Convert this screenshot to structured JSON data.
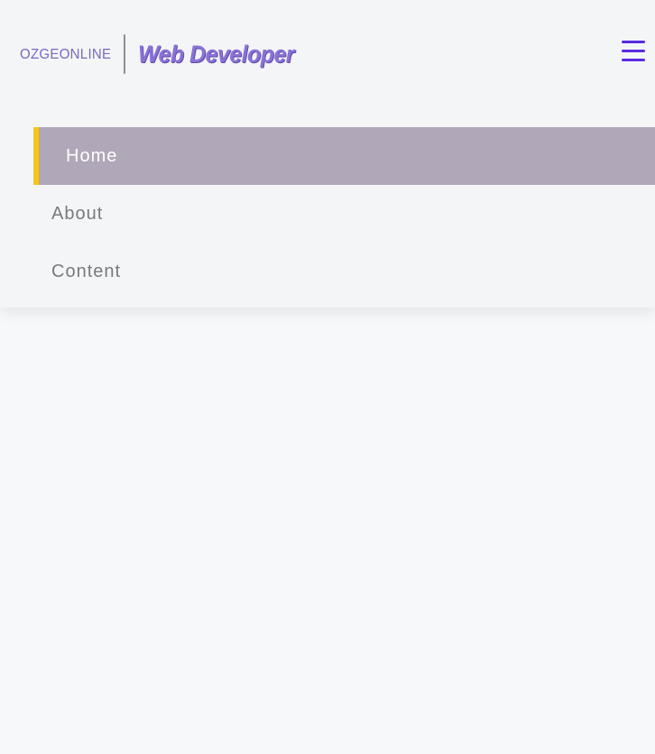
{
  "header": {
    "brand": "OZGEONLINE",
    "title": "Web Developer",
    "menu_icon": "hamburger-menu-icon"
  },
  "nav": {
    "items": [
      {
        "label": "Home",
        "active": true
      },
      {
        "label": "About",
        "active": false
      },
      {
        "label": "Content",
        "active": false
      }
    ]
  },
  "colors": {
    "accent": "#5b2ae0",
    "active_bg": "#b0a7b8",
    "active_marker": "#f5c518",
    "logo_text": "#8a72d6"
  }
}
